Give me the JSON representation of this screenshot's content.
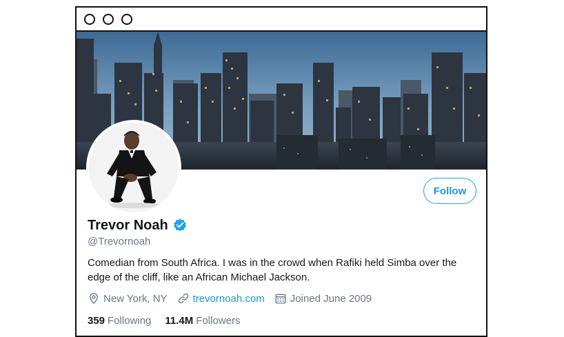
{
  "window": {
    "controls": [
      "close",
      "minimize",
      "maximize"
    ]
  },
  "profile": {
    "display_name": "Trevor Noah",
    "verified_icon": "verified-badge-icon",
    "handle": "@Trevornoah",
    "bio": "Comedian from South Africa. I was in the crowd when Rafiki held Simba over the edge of the cliff, like an African Michael Jackson.",
    "location": "New York, NY",
    "website": "trevornoah.com",
    "joined": "Joined June 2009",
    "follow_label": "Follow"
  },
  "stats": {
    "following_count": "359",
    "following_label": "Following",
    "followers_count": "11.4M",
    "followers_label": "Followers"
  },
  "icons": {
    "location": "map-pin-icon",
    "website": "link-icon",
    "joined": "calendar-icon"
  },
  "colors": {
    "accent": "#1da1f2",
    "link": "#1b95e0",
    "secondary_text": "#657786",
    "primary_text": "#14171a"
  }
}
